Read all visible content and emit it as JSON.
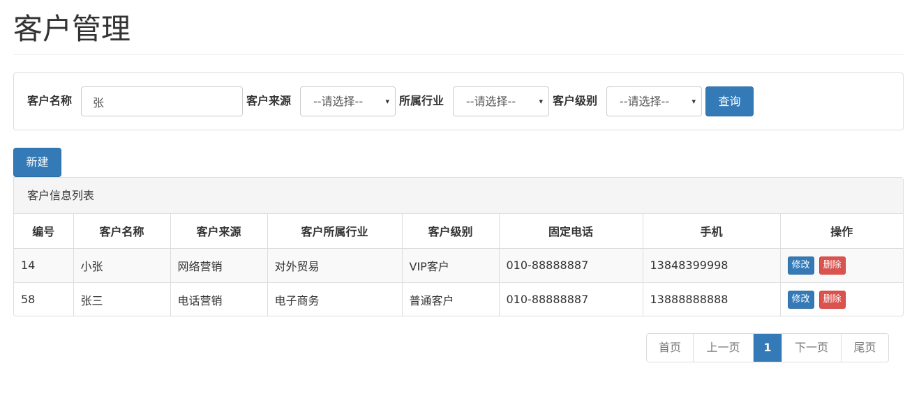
{
  "header": {
    "title": "客户管理"
  },
  "search": {
    "name_label": "客户名称",
    "name_value": "张",
    "source_label": "客户来源",
    "source_selected": "--请选择--",
    "industry_label": "所属行业",
    "industry_selected": "--请选择--",
    "level_label": "客户级别",
    "level_selected": "--请选择--",
    "query_label": "查询",
    "caret_icon": "▾"
  },
  "toolbar": {
    "new_label": "新建"
  },
  "list": {
    "heading": "客户信息列表",
    "columns": [
      "编号",
      "客户名称",
      "客户来源",
      "客户所属行业",
      "客户级别",
      "固定电话",
      "手机",
      "操作"
    ],
    "rows": [
      {
        "id": "14",
        "name": "小张",
        "source": "网络营销",
        "industry": "对外贸易",
        "level": "VIP客户",
        "phone": "010-88888887",
        "mobile": "13848399998",
        "edit": "修改",
        "delete": "删除"
      },
      {
        "id": "58",
        "name": "张三",
        "source": "电话营销",
        "industry": "电子商务",
        "level": "普通客户",
        "phone": "010-88888887",
        "mobile": "13888888888",
        "edit": "修改",
        "delete": "删除"
      }
    ]
  },
  "pagination": {
    "first": "首页",
    "prev": "上一页",
    "current": "1",
    "next": "下一页",
    "last": "尾页"
  },
  "colors": {
    "primary": "#337ab7",
    "danger": "#d9534f",
    "border": "#dddddd"
  }
}
